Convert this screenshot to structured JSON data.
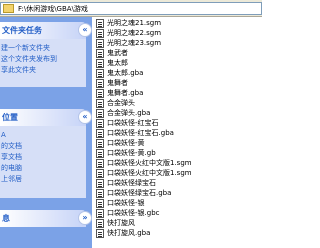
{
  "address": {
    "path": "F:\\休闲游戏\\GBA\\游戏"
  },
  "tasks": {
    "file_tasks": {
      "title": "文件夹任务",
      "toggle": "«",
      "items": [
        "建一个新文件夹",
        "这个文件夹发布到",
        "享此文件夹"
      ]
    },
    "other_places": {
      "title": "位置",
      "toggle": "«",
      "items": [
        "A",
        "的文档",
        "享文档",
        "的电脑",
        "上邻居"
      ]
    },
    "details": {
      "title": "息",
      "toggle": "»"
    }
  },
  "files": [
    "光明之魂21.sgm",
    "光明之魂22.sgm",
    "光明之魂23.sgm",
    "鬼武者",
    "鬼太郎",
    "鬼太郎.gba",
    "鬼舞者",
    "鬼舞者.gba",
    "合金弹头",
    "合金弹头.gba",
    "口袋妖怪-红宝石",
    "口袋妖怪-红宝石.gba",
    "口袋妖怪-黄",
    "口袋妖怪-黄.gb",
    "口袋妖怪火红中文版1.sgm",
    "口袋妖怪火红中文版1.sgm",
    "口袋妖怪绿宝石",
    "口袋妖怪绿宝石.gba",
    "口袋妖怪-银",
    "口袋妖怪-银.gbc",
    "快打旋风",
    "快打旋风.gba"
  ]
}
